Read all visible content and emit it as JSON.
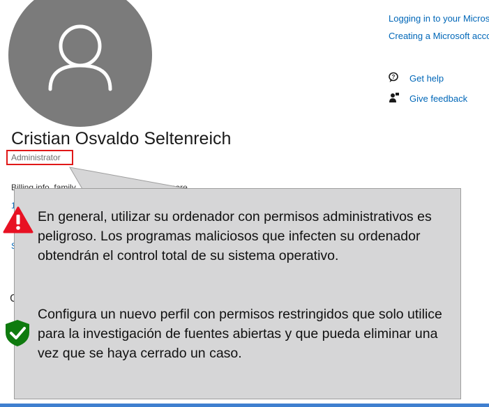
{
  "user": {
    "name": "Cristian Osvaldo Seltenreich",
    "role": "Administrator"
  },
  "background": {
    "description": "Billing info, family ... security settings, and more"
  },
  "right_panel": {
    "links": [
      "Logging in to your Micros",
      "Creating a Microsoft acco"
    ],
    "get_help": "Get help",
    "give_feedback": "Give feedback"
  },
  "callout": {
    "warning_text": "En general, utilizar su ordenador con permisos administrativos es peligroso. Los programas maliciosos que infecten su ordenador obtendrán el control total de su sistema operativo.",
    "advice_text": "Configura un nuevo perfil con permisos restringidos que solo utilice para la investigación de fuentes abiertas y que pueda eliminar una vez que se haya cerrado un caso."
  },
  "icons": {
    "warning": "warning-triangle-icon",
    "shield": "shield-check-icon",
    "help": "help-chat-icon",
    "feedback": "feedback-icon"
  },
  "colors": {
    "accent": "#0067b8",
    "highlight": "#e01818",
    "warning": "#e81123",
    "shield": "#0f7b0f",
    "callout_bg": "#d6d6d7",
    "avatar_bg": "#7b7b7b"
  }
}
